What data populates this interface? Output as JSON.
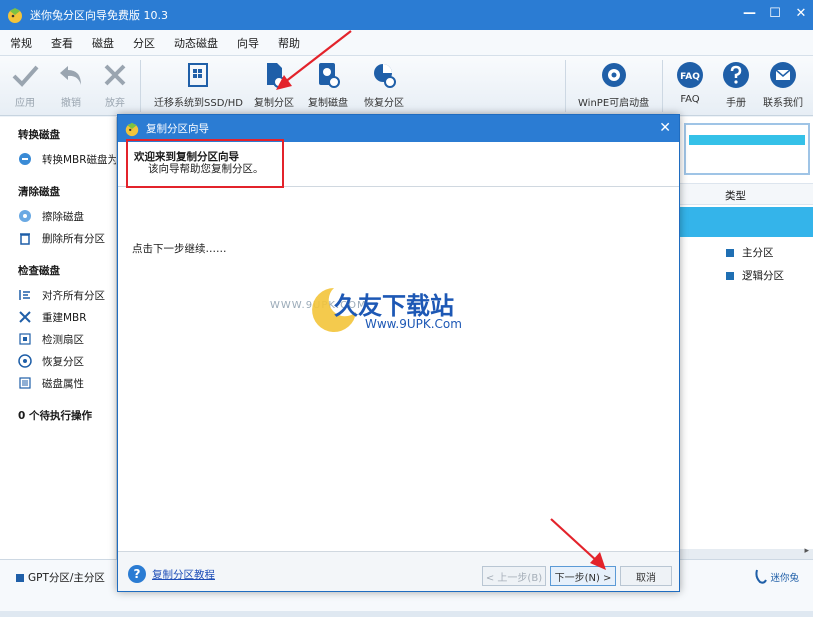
{
  "app": {
    "title": "迷你兔分区向导免费版 10.3",
    "window_controls": {
      "minimize": "—",
      "maximize": "☐",
      "close": "✕"
    }
  },
  "menu": [
    "常规",
    "查看",
    "磁盘",
    "分区",
    "动态磁盘",
    "向导",
    "帮助"
  ],
  "toolbar": {
    "apply": "应用",
    "undo": "撤销",
    "discard": "放弃",
    "migrate": "迁移系统到SSD/HD",
    "copy_partition": "复制分区",
    "copy_disk": "复制磁盘",
    "recover_partition": "恢复分区",
    "winpe": "WinPE可启动盘",
    "faq": "FAQ",
    "faq_icon_text": "FAQ",
    "manual": "手册",
    "contact": "联系我们"
  },
  "sidebar": {
    "groups": [
      {
        "title": "转换磁盘",
        "items": [
          "转换MBR磁盘为GPT"
        ]
      },
      {
        "title": "清除磁盘",
        "items": [
          "擦除磁盘",
          "删除所有分区"
        ]
      },
      {
        "title": "检查磁盘",
        "items": [
          "对齐所有分区",
          "重建MBR",
          "检测扇区",
          "恢复分区",
          "磁盘属性"
        ]
      }
    ],
    "pending": "0 个待执行操作"
  },
  "right_panel": {
    "column_type": "类型",
    "legend": [
      {
        "label": "主分区",
        "color": "#1f6fb3"
      },
      {
        "label": "逻辑分区",
        "color": "#1f6fb3"
      }
    ],
    "scroll_arrow": "▸"
  },
  "status": {
    "legend_label": "GPT分区/主分区",
    "brand": "迷你兔"
  },
  "dialog": {
    "title": "复制分区向导",
    "close": "✕",
    "heading": "欢迎来到复制分区向导",
    "subheading": "该向导帮助您复制分区。",
    "message": "点击下一步继续……",
    "help_icon": "?",
    "help_link": "复制分区教程",
    "back_button": "< 上一步(B)",
    "next_button": "下一步(N) >",
    "cancel_button": "取消"
  },
  "watermark": {
    "www": "WWW.9UPK.COM",
    "cn": "久友下载站",
    "url": "Www.9UPK.Com"
  },
  "colors": {
    "titlebar": "#2b7cd3",
    "accent": "#34b4ea",
    "annotation": "#e3232b"
  }
}
